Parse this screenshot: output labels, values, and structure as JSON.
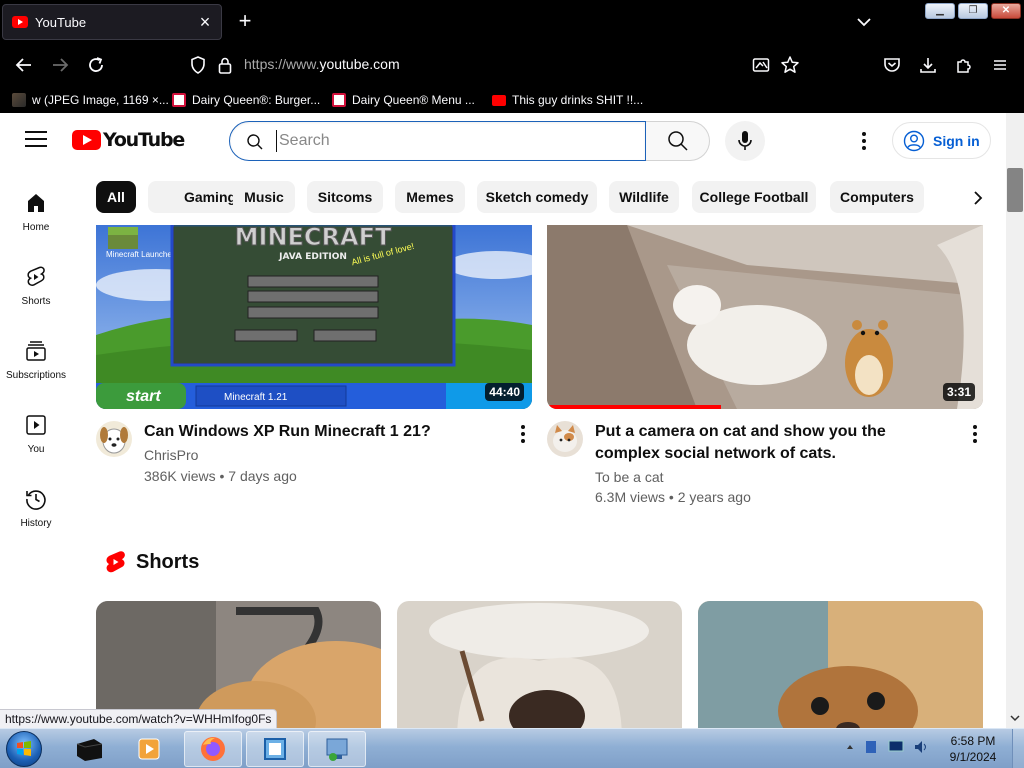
{
  "browser": {
    "tab": {
      "title": "YouTube"
    },
    "url": {
      "prefix": "https://www.",
      "domain": "youtube.com"
    },
    "bookmarks": [
      {
        "label": "w (JPEG Image, 1169 ×...",
        "icon": "image-bookmark-icon"
      },
      {
        "label": "Dairy Queen®: Burger...",
        "icon": "dairy-queen-icon"
      },
      {
        "label": "Dairy Queen® Menu ...",
        "icon": "dairy-queen-icon"
      },
      {
        "label": "This guy drinks SHIT !!...",
        "icon": "youtube-favicon-icon"
      }
    ]
  },
  "youtube": {
    "logo_text": "YouTube",
    "search": {
      "placeholder": "Search"
    },
    "signin_label": "Sign in",
    "guide": [
      {
        "label": "Home",
        "icon": "home-icon"
      },
      {
        "label": "Shorts",
        "icon": "shorts-icon"
      },
      {
        "label": "Subscriptions",
        "icon": "subscriptions-icon"
      },
      {
        "label": "You",
        "icon": "you-icon"
      },
      {
        "label": "History",
        "icon": "history-icon"
      }
    ],
    "chips": [
      "All",
      "Gaming",
      "Music",
      "Sitcoms",
      "Memes",
      "Sketch comedy",
      "Wildlife",
      "College Football",
      "Computers"
    ],
    "active_chip": "All",
    "videos": [
      {
        "title": "Can Windows XP Run Minecraft 1 21?",
        "channel": "ChrisPro",
        "meta": "386K views • 7 days ago",
        "duration": "44:40",
        "thumb_texts": {
          "game_title": "MINECRAFT",
          "edition": "JAVA EDITION",
          "splash": "All is full of love!",
          "start": "start",
          "task": "Minecraft 1.21",
          "launcher": "Minecraft Launcher"
        }
      },
      {
        "title": "Put a camera on cat and show you the complex social network of cats.",
        "channel": "To be a cat",
        "meta": "6.3M views • 2 years ago",
        "duration": "3:31",
        "watched_fraction": 0.4
      }
    ],
    "shorts_title": "Shorts"
  },
  "status_url": "https://www.youtube.com/watch?v=WHHmIfog0Fs",
  "taskbar": {
    "clock_time": "6:58 PM",
    "clock_date": "9/1/2024"
  },
  "colors": {
    "brand_red": "#ff0000",
    "link_blue": "#065fd4",
    "chrome_bg": "#000000"
  }
}
